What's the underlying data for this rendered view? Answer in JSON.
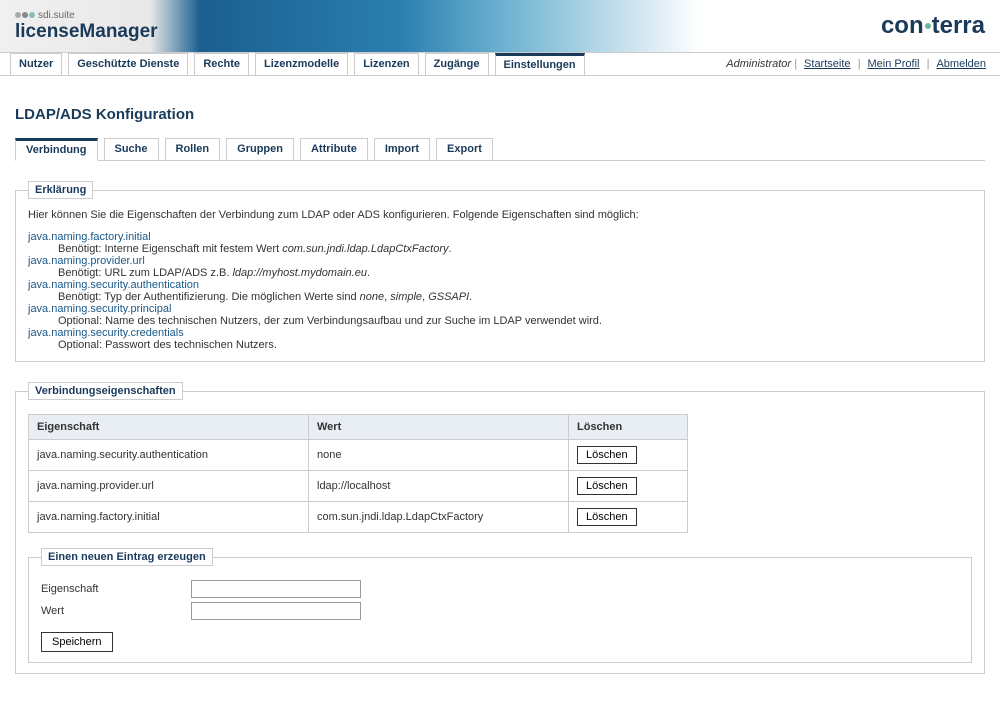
{
  "header": {
    "suite_label": "sdi.suite",
    "brand": "licenseManager",
    "company_prefix": "con",
    "company_suffix": "terra"
  },
  "user_links": {
    "administrator": "Administrator",
    "startseite": "Startseite",
    "mein_profil": "Mein Profil",
    "abmelden": "Abmelden"
  },
  "main_tabs": {
    "nutzer": "Nutzer",
    "geschuetzte_dienste": "Geschützte Dienste",
    "rechte": "Rechte",
    "lizenzmodelle": "Lizenzmodelle",
    "lizenzen": "Lizenzen",
    "zugaenge": "Zugänge",
    "einstellungen": "Einstellungen"
  },
  "page_title": "LDAP/ADS Konfiguration",
  "sub_tabs": {
    "verbindung": "Verbindung",
    "suche": "Suche",
    "rollen": "Rollen",
    "gruppen": "Gruppen",
    "attribute": "Attribute",
    "import": "Import",
    "export": "Export"
  },
  "explain": {
    "legend": "Erklärung",
    "intro": "Hier können Sie die Eigenschaften der Verbindung zum LDAP oder ADS konfigurieren. Folgende Eigenschaften sind möglich:",
    "p1_name": "java.naming.factory.initial",
    "p1_desc_a": "Benötigt: Interne Eigenschaft mit festem Wert ",
    "p1_desc_b": "com.sun.jndi.ldap.LdapCtxFactory",
    "p1_desc_c": ".",
    "p2_name": "java.naming.provider.url",
    "p2_desc_a": "Benötigt: URL zum LDAP/ADS z.B. ",
    "p2_desc_b": "ldap://myhost.mydomain.eu",
    "p2_desc_c": ".",
    "p3_name": "java.naming.security.authentication",
    "p3_desc_a": "Benötigt: Typ der Authentifizierung. Die möglichen Werte sind ",
    "p3_desc_b": "none",
    "p3_desc_c": ", ",
    "p3_desc_d": "simple",
    "p3_desc_e": ", ",
    "p3_desc_f": "GSSAPI",
    "p3_desc_g": ".",
    "p4_name": "java.naming.security.principal",
    "p4_desc": "Optional: Name des technischen Nutzers, der zum Verbindungsaufbau und zur Suche im LDAP verwendet wird.",
    "p5_name": "java.naming.security.credentials",
    "p5_desc": "Optional: Passwort des technischen Nutzers."
  },
  "props_section": {
    "legend": "Verbindungseigenschaften",
    "col_eigenschaft": "Eigenschaft",
    "col_wert": "Wert",
    "col_loeschen": "Löschen",
    "delete_label": "Löschen",
    "rows": [
      {
        "name": "java.naming.security.authentication",
        "value": "none"
      },
      {
        "name": "java.naming.provider.url",
        "value": "ldap://localhost"
      },
      {
        "name": "java.naming.factory.initial",
        "value": "com.sun.jndi.ldap.LdapCtxFactory"
      }
    ]
  },
  "new_entry": {
    "legend": "Einen neuen Eintrag erzeugen",
    "label_eigenschaft": "Eigenschaft",
    "label_wert": "Wert",
    "save": "Speichern"
  }
}
